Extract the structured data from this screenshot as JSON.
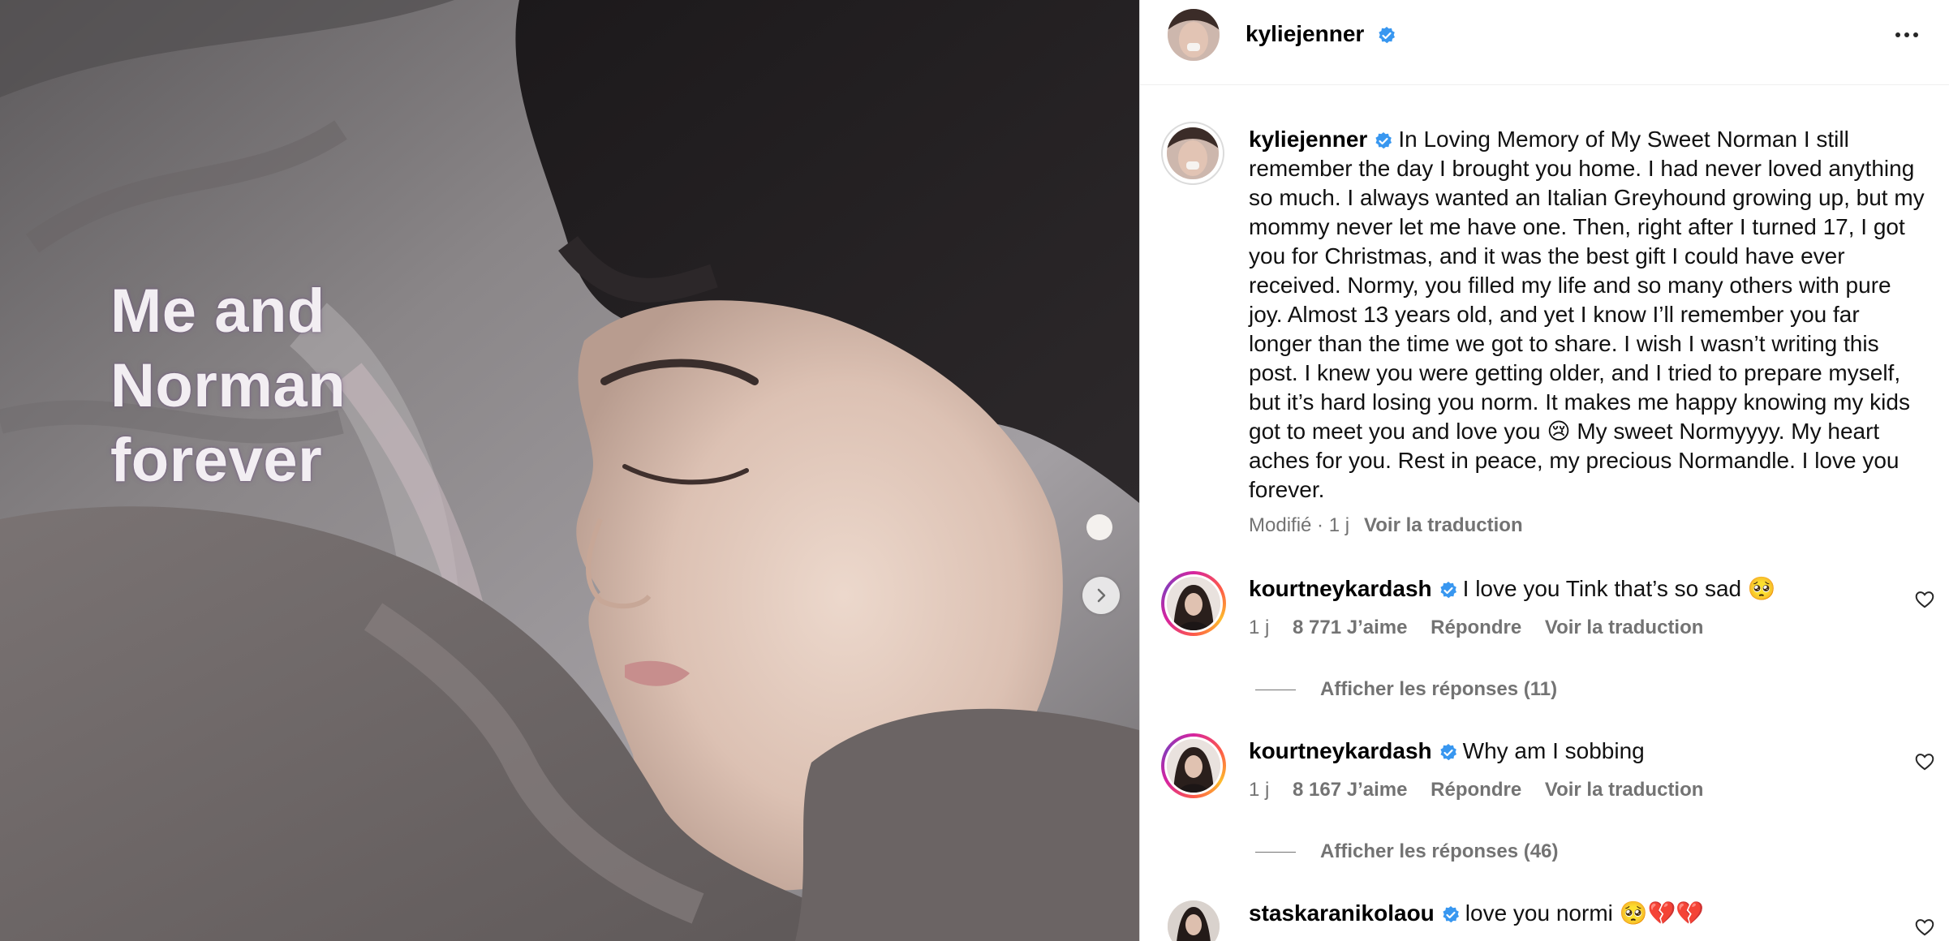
{
  "post": {
    "username": "kyliejenner",
    "more_icon": "more-horizontal-icon",
    "media": {
      "overlay_text": "Me and\nNorman\nforever",
      "next_icon": "chevron-right-icon"
    },
    "caption": {
      "username": "kyliejenner",
      "text": "In Loving Memory of My Sweet Norman I still remember the day I brought you home. I had never loved anything so much. I always wanted an Italian Greyhound growing up, but my mommy never let me have one. Then, right after I turned 17, I got you for Christmas, and it was the best gift I could have ever received. Normy, you filled my life and so many others with pure joy. Almost 13 years old, and yet I know I’ll remember you far longer than the time we got to share. I wish I wasn’t writing this post. I knew you were getting older, and I tried to prepare myself, but it’s hard losing you norm. It makes me happy knowing my kids got to meet you and love you 😢 My sweet Normyyyy. My heart aches for you. Rest in peace, my precious Normandle. I love you forever.",
      "edited": "Modifié · 1 j",
      "translate": "Voir la traduction"
    },
    "comments": [
      {
        "username": "kourtneykardash",
        "text": "I love you Tink that’s so sad 🥺",
        "age": "1 j",
        "likes": "8 771 J’aime",
        "reply": "Répondre",
        "translate": "Voir la traduction",
        "view_replies": "Afficher les réponses (11)"
      },
      {
        "username": "kourtneykardash",
        "text": "Why am I sobbing",
        "age": "1 j",
        "likes": "8 167 J’aime",
        "reply": "Répondre",
        "translate": "Voir la traduction",
        "view_replies": "Afficher les réponses (46)"
      },
      {
        "username": "staskaranikolaou",
        "text": "love you normi 🥺💔💔"
      }
    ]
  },
  "colors": {
    "verified": "#3897f0",
    "secondary_text": "#737373",
    "border": "#dbdbdb"
  }
}
